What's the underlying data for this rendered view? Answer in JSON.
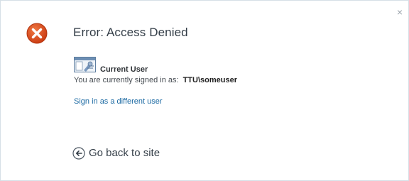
{
  "dialog": {
    "close_glyph": "×",
    "title": "Error: Access Denied",
    "icons": {
      "error": "error-x-icon",
      "user": "current-user-icon",
      "back": "back-arrow-icon"
    },
    "colors": {
      "error_red": "#d84a1b",
      "link_blue": "#1c6aa3",
      "text_dark": "#333d47"
    }
  },
  "user": {
    "heading": "Current User",
    "signed_in_label": "You are currently signed in as:",
    "username": "TTU\\someuser",
    "switch_link": "Sign in as a different user"
  },
  "footer": {
    "back_label": "Go back to site"
  }
}
